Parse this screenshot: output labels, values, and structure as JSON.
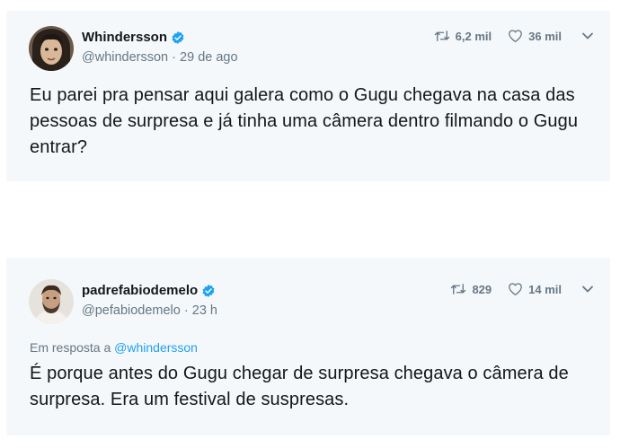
{
  "tweets": [
    {
      "display_name": "Whindersson",
      "verified_icon": "verified-badge-icon",
      "handle": "@whindersson",
      "separator": "·",
      "timestamp": "29 de ago",
      "retweets": "6,2 mil",
      "likes": "36 mil",
      "text": "Eu parei pra pensar aqui galera como o Gugu chegava na casa das pessoas de surpresa e já tinha uma câmera dentro filmando o Gugu entrar?"
    },
    {
      "display_name": "padrefabiodemelo",
      "verified_icon": "verified-badge-icon",
      "handle": "@pefabiodemelo",
      "separator": "·",
      "timestamp": "23 h",
      "retweets": "829",
      "likes": "14 mil",
      "reply_prefix": "Em resposta a",
      "reply_to": "@whindersson",
      "text": "É porque antes do Gugu chegar de surpresa chegava o câmera de surpresa. Era um festival de suspresas."
    }
  ],
  "colors": {
    "card_background": "#f5f8fa",
    "text_primary": "#14171a",
    "text_secondary": "#657786",
    "link_blue": "#1da1f2",
    "verified_blue": "#1da1f2"
  }
}
